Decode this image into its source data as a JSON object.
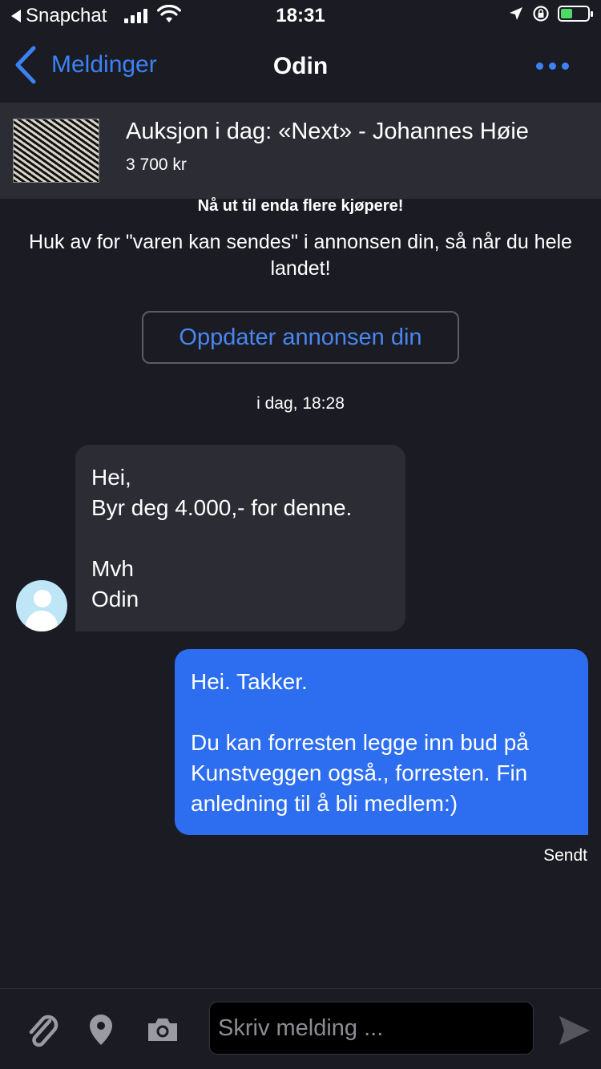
{
  "status_bar": {
    "back_app": "Snapchat",
    "time": "18:31",
    "battery_level": 0.45,
    "icons": [
      "signal-icon",
      "wifi-icon",
      "location-icon",
      "rotation-lock-icon",
      "battery-icon"
    ]
  },
  "nav": {
    "back_label": "Meldinger",
    "title": "Odin",
    "more_icon": "more-icon"
  },
  "listing": {
    "title": "Auksjon i dag: «Next» - Johannes Høie",
    "price": "3 700 kr"
  },
  "promo": {
    "heading": "Nå ut til enda flere kjøpere!",
    "body": "Huk av for \"varen kan sendes\" i annonsen din, så når du hele landet!",
    "button_label": "Oppdater annonsen din"
  },
  "timestamp": "i dag, 18:28",
  "messages": [
    {
      "direction": "incoming",
      "text": "Hei,\nByr deg 4.000,- for denne.\n\nMvh\nOdin"
    },
    {
      "direction": "outgoing",
      "text": "Hei. Takker.\n\nDu kan forresten legge inn bud på Kunstveggen også., forresten. Fin anledning til å bli medlem:)"
    }
  ],
  "sent_status": "Sendt",
  "composer": {
    "placeholder": "Skriv melding ...",
    "value": "",
    "icons": [
      "paperclip-icon",
      "location-pin-icon",
      "camera-icon",
      "send-icon"
    ]
  },
  "colors": {
    "background": "#1b1c23",
    "surface": "#2b2c34",
    "accent": "#3b82f6",
    "outgoing_bubble": "#2d6ef0"
  }
}
